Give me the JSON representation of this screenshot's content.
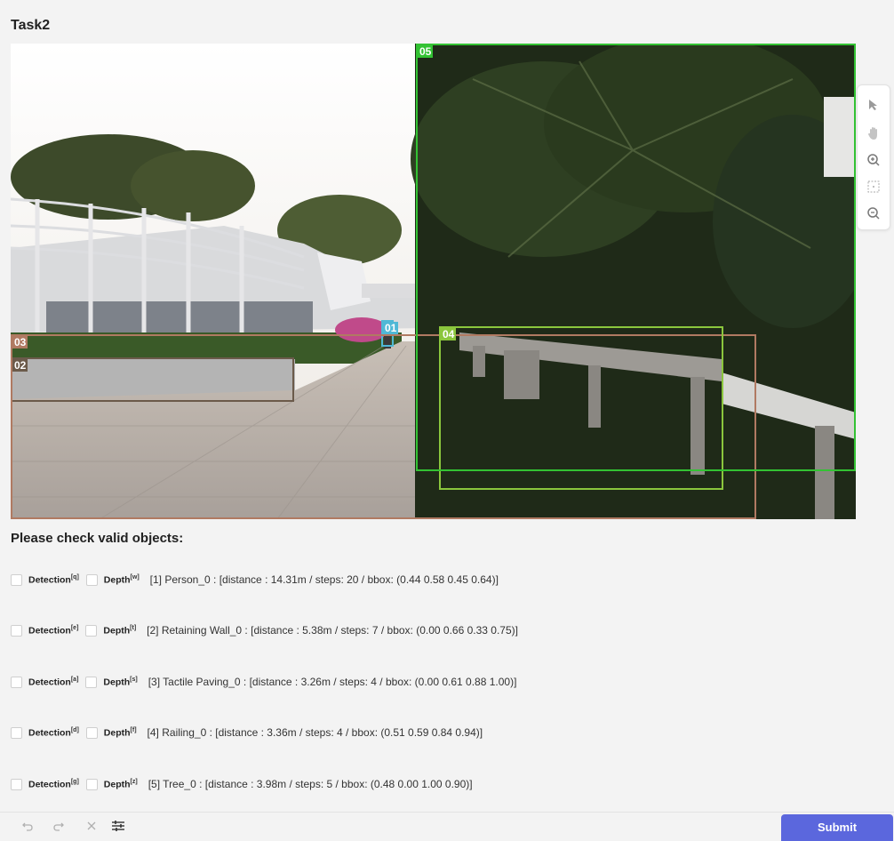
{
  "task": {
    "title": "Task2"
  },
  "image": {
    "boxes": [
      {
        "tag": "01",
        "color": "#4fb8d6"
      },
      {
        "tag": "02",
        "color": "#6b5a4a"
      },
      {
        "tag": "03",
        "color": "#b07a62"
      },
      {
        "tag": "04",
        "color": "#8bc63d"
      },
      {
        "tag": "05",
        "color": "#33c233"
      }
    ]
  },
  "zoom_toolbar": {
    "tools": [
      {
        "name": "select-icon",
        "icon": "arrow-cursor"
      },
      {
        "name": "pan-icon",
        "icon": "hand"
      },
      {
        "name": "zoom-in-icon",
        "icon": "magnifier-plus"
      },
      {
        "name": "fit-icon",
        "icon": "frame"
      },
      {
        "name": "zoom-out-icon",
        "icon": "magnifier-minus"
      }
    ]
  },
  "check": {
    "title": "Please check valid objects:",
    "detection_label": "Detection",
    "depth_label": "Depth",
    "objects": [
      {
        "det_key": "[q]",
        "depth_key": "[w]",
        "text": "[1] Person_0 : [distance : 14.31m / steps: 20 / bbox: (0.44 0.58 0.45 0.64)]"
      },
      {
        "det_key": "[e]",
        "depth_key": "[t]",
        "text": "[2] Retaining Wall_0 : [distance : 5.38m / steps: 7 / bbox: (0.00 0.66 0.33 0.75)]"
      },
      {
        "det_key": "[a]",
        "depth_key": "[s]",
        "text": "[3] Tactile Paving_0 : [distance : 3.26m / steps: 4 / bbox: (0.00 0.61 0.88 1.00)]"
      },
      {
        "det_key": "[d]",
        "depth_key": "[f]",
        "text": "[4] Railing_0 : [distance : 3.36m / steps: 4 / bbox: (0.51 0.59 0.84 0.94)]"
      },
      {
        "det_key": "[g]",
        "depth_key": "[z]",
        "text": "[5] Tree_0 : [distance : 3.98m / steps: 5 / bbox: (0.48 0.00 1.00 0.90)]"
      }
    ]
  },
  "bottom": {
    "undo_icon": "undo-arrow",
    "redo_icon": "redo-arrow",
    "clear_icon": "x-mark",
    "settings_icon": "sliders",
    "submit_label": "Submit",
    "accent": "#5b67dd"
  }
}
